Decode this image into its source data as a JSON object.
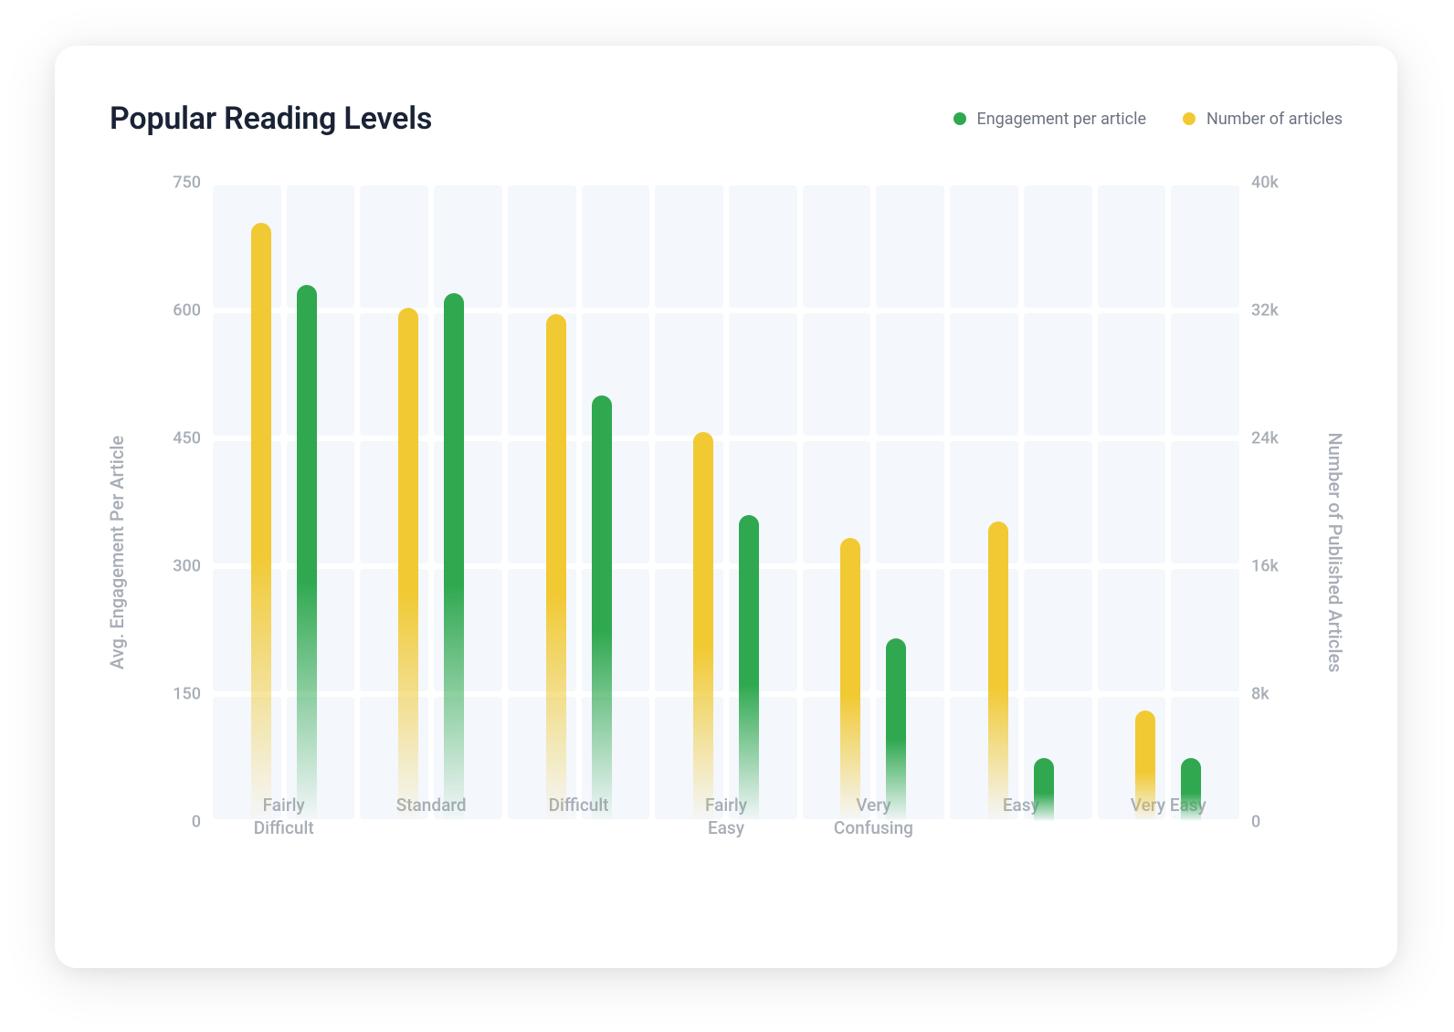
{
  "title": "Popular Reading Levels",
  "legend": {
    "engagement": "Engagement per article",
    "articles": "Number of articles"
  },
  "axes": {
    "left_label": "Avg. Engagement Per Article",
    "right_label": "Number of Published Articles",
    "left_ticks": [
      "0",
      "150",
      "300",
      "450",
      "600",
      "750"
    ],
    "right_ticks": [
      "0",
      "8k",
      "16k",
      "24k",
      "32k",
      "40k"
    ]
  },
  "chart_data": {
    "type": "bar",
    "title": "Popular Reading Levels",
    "xlabel": "",
    "ylabel": "Avg. Engagement Per Article",
    "y2label": "Number of Published Articles",
    "ylim": [
      0,
      750
    ],
    "y2lim": [
      0,
      40000
    ],
    "categories": [
      "Fairly Difficult",
      "Standard",
      "Difficult",
      "Fairly Easy",
      "Very Confusing",
      "Easy",
      "Very Easy"
    ],
    "category_labels_wrapped": [
      "Fairly\nDifficult",
      "Standard",
      "Difficult",
      "Fairly\nEasy",
      "Very\nConfusing",
      "Easy",
      "Very Easy"
    ],
    "series": [
      {
        "name": "Number of articles",
        "axis": "right",
        "color": "#f1c932",
        "values": [
          37500,
          32200,
          31800,
          24400,
          17800,
          18800,
          7000
        ]
      },
      {
        "name": "Engagement per article",
        "axis": "left",
        "color": "#2fa84f",
        "values": [
          630,
          620,
          500,
          360,
          215,
          75,
          75
        ]
      }
    ]
  },
  "colors": {
    "yellow": "#f1c932",
    "green": "#2fa84f",
    "grid": "#f4f7fb",
    "text_primary": "#1a2236",
    "text_muted": "#a7adb6"
  }
}
